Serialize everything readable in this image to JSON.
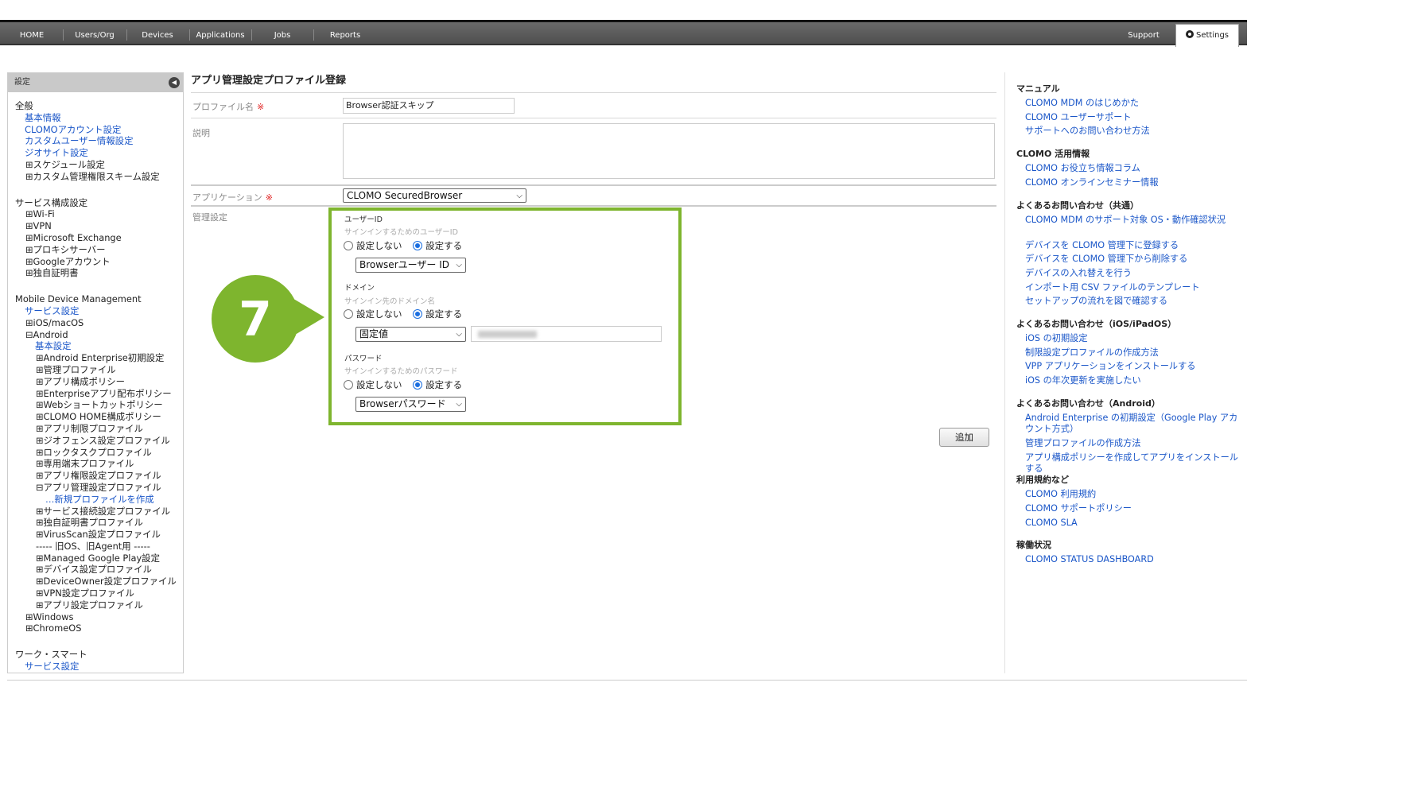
{
  "nav": {
    "items": [
      "HOME",
      "Users/Org",
      "Devices",
      "Applications",
      "Jobs",
      "Reports"
    ],
    "support": "Support",
    "settings": "Settings"
  },
  "sidebar": {
    "header": "設定",
    "items": [
      {
        "t": "全般",
        "s": "h"
      },
      {
        "t": "基本情報",
        "s": "l1"
      },
      {
        "t": "CLOMOアカウント設定",
        "s": "l1"
      },
      {
        "t": "カスタムユーザー情報設定",
        "s": "l1"
      },
      {
        "t": "ジオサイト設定",
        "s": "l1"
      },
      {
        "t": "⊞スケジュール設定",
        "s": "p1"
      },
      {
        "t": "⊞カスタム管理権限スキーム設定",
        "s": "p1"
      },
      {
        "t": "",
        "s": "gap"
      },
      {
        "t": "サービス構成設定",
        "s": "h"
      },
      {
        "t": "⊞Wi-Fi",
        "s": "p1"
      },
      {
        "t": "⊞VPN",
        "s": "p1"
      },
      {
        "t": "⊞Microsoft Exchange",
        "s": "p1"
      },
      {
        "t": "⊞プロキシサーバー",
        "s": "p1"
      },
      {
        "t": "⊞Googleアカウント",
        "s": "p1"
      },
      {
        "t": "⊞独自証明書",
        "s": "p1"
      },
      {
        "t": "",
        "s": "gap"
      },
      {
        "t": "Mobile Device Management",
        "s": "h"
      },
      {
        "t": "サービス設定",
        "s": "l1"
      },
      {
        "t": "⊞iOS/macOS",
        "s": "p1"
      },
      {
        "t": "⊟Android",
        "s": "p1"
      },
      {
        "t": "基本設定",
        "s": "l2"
      },
      {
        "t": "⊞Android Enterprise初期設定",
        "s": "p2"
      },
      {
        "t": "⊞管理プロファイル",
        "s": "p2"
      },
      {
        "t": "⊞アプリ構成ポリシー",
        "s": "p2"
      },
      {
        "t": "⊞Enterpriseアプリ配布ポリシー",
        "s": "p2"
      },
      {
        "t": "⊞Webショートカットポリシー",
        "s": "p2"
      },
      {
        "t": "⊞CLOMO HOME構成ポリシー",
        "s": "p2"
      },
      {
        "t": "⊞アプリ制限プロファイル",
        "s": "p2"
      },
      {
        "t": "⊞ジオフェンス設定プロファイル",
        "s": "p2"
      },
      {
        "t": "⊞ロックタスクプロファイル",
        "s": "p2"
      },
      {
        "t": "⊞専用端末プロファイル",
        "s": "p2"
      },
      {
        "t": "⊞アプリ権限設定プロファイル",
        "s": "p2"
      },
      {
        "t": "⊟アプリ管理設定プロファイル",
        "s": "p2"
      },
      {
        "t": "…新規プロファイルを作成",
        "s": "l3"
      },
      {
        "t": "⊞サービス接続設定プロファイル",
        "s": "p2"
      },
      {
        "t": "⊞独自証明書プロファイル",
        "s": "p2"
      },
      {
        "t": "⊞VirusScan設定プロファイル",
        "s": "p2"
      },
      {
        "t": "----- 旧OS、旧Agent用 -----",
        "s": "p2d"
      },
      {
        "t": "⊞Managed Google Play設定",
        "s": "p2"
      },
      {
        "t": "⊞デバイス設定プロファイル",
        "s": "p2"
      },
      {
        "t": "⊞DeviceOwner設定プロファイル",
        "s": "p2"
      },
      {
        "t": "⊞VPN設定プロファイル",
        "s": "p2"
      },
      {
        "t": "⊞アプリ設定プロファイル",
        "s": "p2"
      },
      {
        "t": "⊞Windows",
        "s": "p1"
      },
      {
        "t": "⊞ChromeOS",
        "s": "p1"
      },
      {
        "t": "",
        "s": "gap"
      },
      {
        "t": "ワーク・スマート",
        "s": "h"
      },
      {
        "t": "サービス設定",
        "s": "l1"
      }
    ]
  },
  "form": {
    "title": "アプリ管理設定プロファイル登録",
    "profile_name_label": "プロファイル名",
    "required_mark": "※",
    "profile_name_value": "Browser認証スキップ",
    "description_label": "説明",
    "application_label": "アプリケーション",
    "application_value": "CLOMO SecuredBrowser",
    "management_label": "管理設定",
    "user_id": {
      "label": "ユーザーID",
      "sub": "サインインするためのユーザーID",
      "off": "設定しない",
      "on": "設定する",
      "select": "Browserユーザー ID"
    },
    "domain": {
      "label": "ドメイン",
      "sub": "サインイン先のドメイン名",
      "off": "設定しない",
      "on": "設定する",
      "select": "固定値"
    },
    "password": {
      "label": "パスワード",
      "sub": "サインインするためのパスワード",
      "off": "設定しない",
      "on": "設定する",
      "select": "Browserパスワード"
    },
    "add_button": "追加"
  },
  "callout": {
    "number": "7",
    "color": "#7eb52e"
  },
  "right_panel": {
    "sections": [
      {
        "title": "マニュアル",
        "links": [
          "CLOMO MDM のはじめかた",
          "CLOMO ユーザーサポート",
          "サポートへのお問い合わせ方法"
        ]
      },
      {
        "title": "CLOMO 活用情報",
        "links": [
          "CLOMO お役立ち情報コラム",
          "CLOMO オンラインセミナー情報"
        ]
      },
      {
        "title": "よくあるお問い合わせ（共通）",
        "links": [
          "CLOMO MDM のサポート対象 OS・動作確認状況",
          "デバイスを CLOMO 管理下に登録する",
          "デバイスを CLOMO 管理下から削除する",
          "デバイスの入れ替えを行う",
          "インポート用 CSV ファイルのテンプレート",
          "セットアップの流れを図で確認する"
        ]
      },
      {
        "title": "よくあるお問い合わせ（iOS/iPadOS）",
        "links": [
          "iOS の初期設定",
          "制限設定プロファイルの作成方法",
          "VPP アプリケーションをインストールする",
          "iOS の年次更新を実施したい"
        ]
      },
      {
        "title": "よくあるお問い合わせ（Android）",
        "links": [
          "Android Enterprise の初期設定（Google Play アカウント方式）",
          "管理プロファイルの作成方法",
          "アプリ構成ポリシーを作成してアプリをインストールする"
        ]
      },
      {
        "title": "利用規約など",
        "links": [
          "CLOMO 利用規約",
          "CLOMO サポートポリシー",
          "CLOMO SLA"
        ]
      },
      {
        "title": "稼働状況",
        "links": [
          "CLOMO STATUS DASHBOARD"
        ]
      }
    ]
  }
}
